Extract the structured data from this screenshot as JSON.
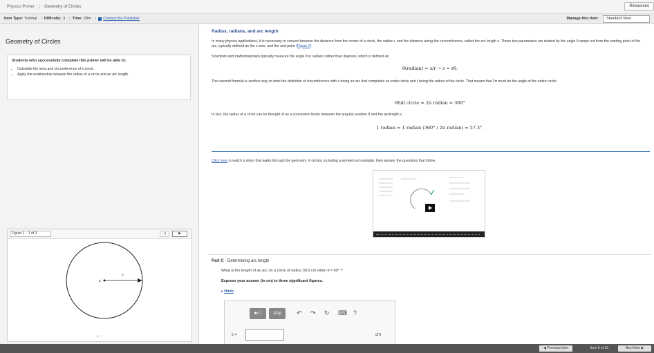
{
  "topbar": {
    "crumb_1": "Physics Primer",
    "crumb_2": "Geometry of Circles",
    "resources_label": "Resources"
  },
  "infobar": {
    "item_type_label": "Item Type:",
    "item_type_value": "Tutorial",
    "difficulty_label": "Difficulty:",
    "difficulty_value": "3",
    "time_label": "Time:",
    "time_value": "20m",
    "contact_label": "Contact the Publisher",
    "manage_label": "Manage this Item:",
    "view_selected": "Standard View"
  },
  "left": {
    "title": "Geometry of Circles",
    "objectives_heading": "Students who successfully complete this primer will be able to:",
    "objectives": [
      "Calculate the area and circumference of a circle.",
      "Apply the relationship between the radius of a circle and an arc length."
    ],
    "figure_select": "Figure 1",
    "figure_of": "1 of 2",
    "figure_next": "▶",
    "figure_prev": "◀",
    "figure_label_s": "s",
    "figure_label_r": "r",
    "figure_dots": "● ○"
  },
  "main": {
    "section_title": "Radius, radians, and arc length",
    "p1": "In many physics applications, it is necessary to convert between the distance from the center of a circle, the radius r, and the distance along the circumference, called the arc length s. These two parameters are related by the angle θ swept out from the starting point of the arc, typically defined as the x-axis, and the end point",
    "p1_link": "(Figure 2)",
    "p2": "Scientists and mathematicians typically measure the angle θ in radians rather than degrees, which is defined as:",
    "eq1": "θ(radian) = s/r → s = rθ.",
    "p3": "This second formula is another way to write the definition of circumference with s being an arc that completes an entire circle and r being the radius of the circle. That means that 2π must be the angle of the entire circle:",
    "eq2": "θfull circle = 2π radian = 360°",
    "p4": "In fact, the radius of a circle can be thought of as a conversion factor between the angular position θ and the arclength s:",
    "eq3": "1 radian = 1 radian (360° / 2π radian) = 57.3°.",
    "video_link": "Click here",
    "video_text": " to watch a video that walks through the geometry of circles, including a worked-out example, then answer the questions that follow.",
    "part_label": "Part C",
    "part_title": " - Determining arc length",
    "question": "What is the length of an arc on a circle of radius 30.0 cm when θ = 60° ?",
    "express": "Express your answer (in cm) to three significant figures.",
    "hints": "Hints",
    "answer_var": "s =",
    "answer_unit": "cm",
    "tools": {
      "t1": "■√□",
      "t2": "AΣφ"
    }
  },
  "bottombar": {
    "prev_label": "◀ Previous Item",
    "count": "Item 3 of 12",
    "next_label": "Next Item ▶"
  }
}
